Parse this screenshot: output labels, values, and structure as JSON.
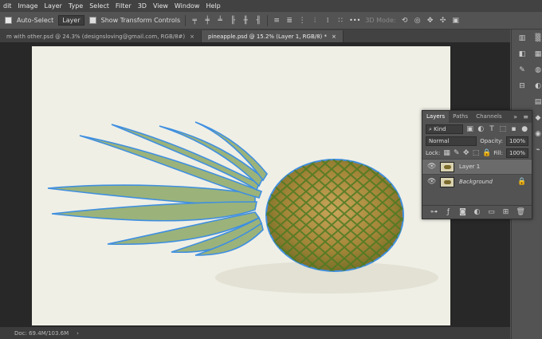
{
  "menu": [
    "dit",
    "Image",
    "Layer",
    "Type",
    "Select",
    "Filter",
    "3D",
    "View",
    "Window",
    "Help"
  ],
  "options": {
    "auto_select_label": "Auto-Select",
    "target_value": "Layer",
    "show_transform_label": "Show Transform Controls",
    "mode_3d_label": "3D Mode:",
    "more_label": "•••"
  },
  "tabs": [
    {
      "label": "m with other.psd @ 24.3% (designsloving@gmail.com, RGB/8#)",
      "close": "×"
    },
    {
      "label": "pineapple.psd @ 15.2% (Layer 1, RGB/8) *",
      "close": "×"
    }
  ],
  "status": {
    "doc": "Doc: 69.4M/103.6M",
    "arrow": "›"
  },
  "layers_panel": {
    "tabs": [
      "Layers",
      "Paths",
      "Channels"
    ],
    "kind_label": "Kind",
    "blend_mode": "Normal",
    "opacity_label": "Opacity:",
    "opacity_value": "100%",
    "lock_label": "Lock:",
    "fill_label": "Fill:",
    "fill_value": "100%",
    "layers": [
      {
        "name": "Layer 1",
        "selected": true
      },
      {
        "name": "Background",
        "selected": false
      }
    ]
  },
  "colors": {
    "accent_outline": "#3f8fe0",
    "panel_bg": "#535353",
    "canvas_bg": "#282828"
  }
}
